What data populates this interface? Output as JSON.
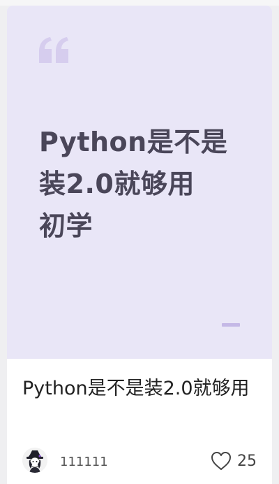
{
  "note": {
    "cover_lines": [
      "Python是不是",
      "装2.0就够用",
      "初学"
    ],
    "title": "Python是不是装2.0就够用",
    "author": "111111",
    "likes": "25"
  },
  "icons": {
    "quote": "quote-mark-icon",
    "like": "heart-outline-icon"
  },
  "colors": {
    "cover_bg": "#e9e6f7",
    "cover_text": "#4a4659",
    "accent": "#c4b8e6"
  }
}
